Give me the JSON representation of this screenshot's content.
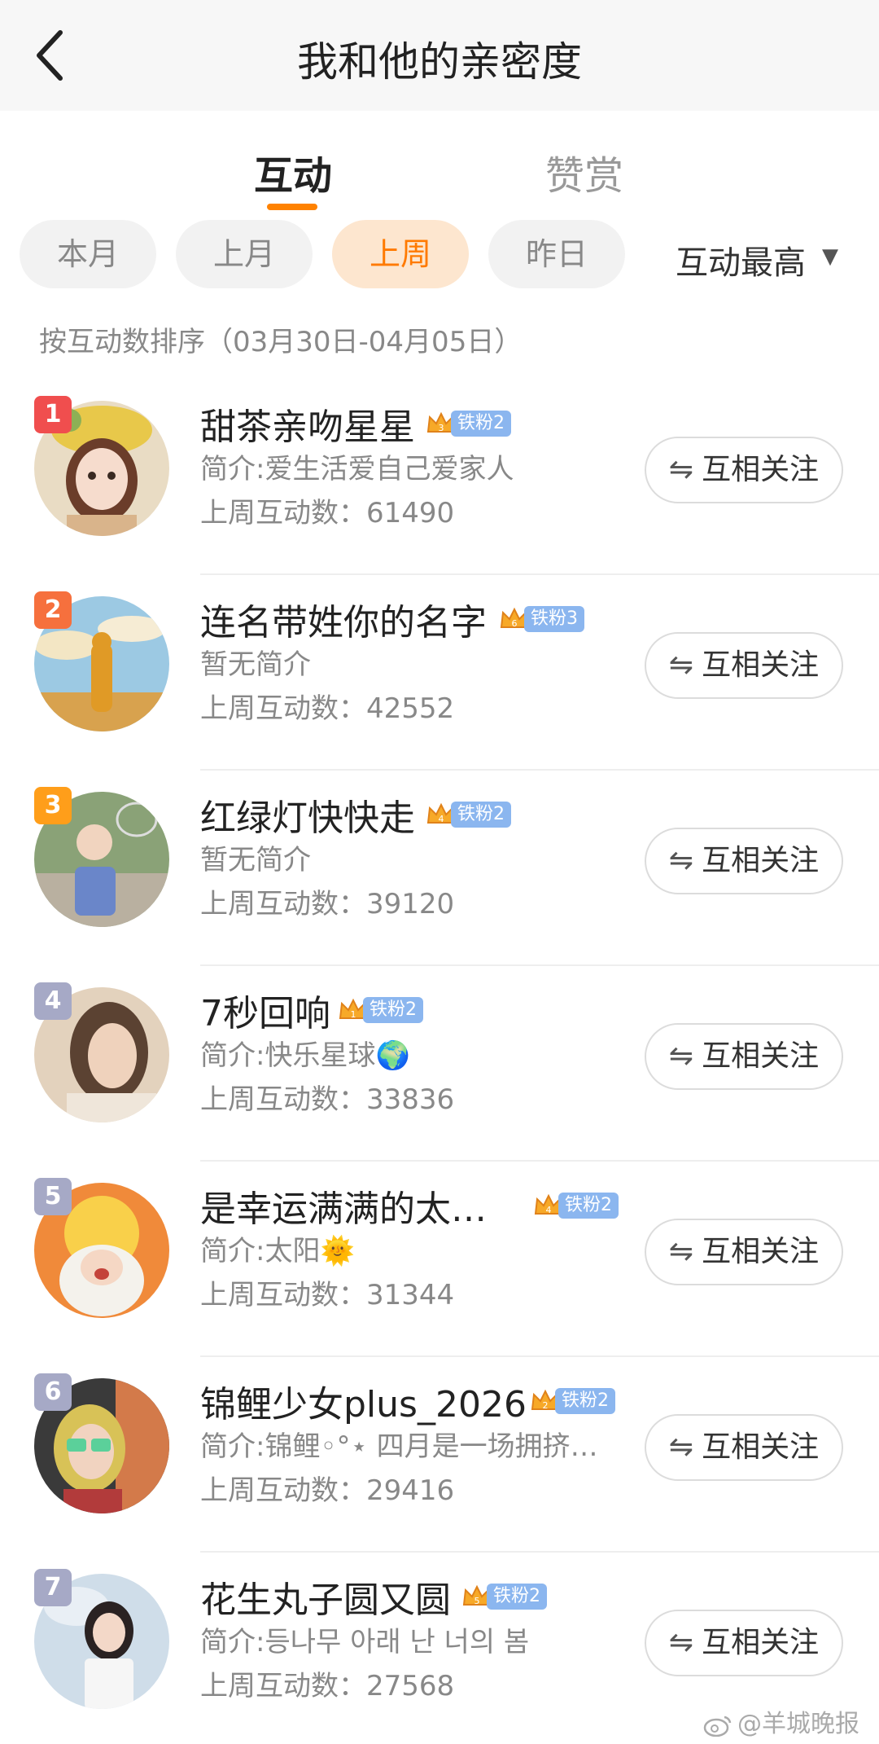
{
  "header": {
    "title": "我和他的亲密度",
    "back_icon": "chevron-left-icon"
  },
  "tabs": [
    {
      "label": "互动",
      "active": true
    },
    {
      "label": "赞赏",
      "active": false
    }
  ],
  "filters": {
    "chips": [
      "本月",
      "上月",
      "上周",
      "昨日"
    ],
    "active": "上周",
    "sort_label": "互动最高",
    "sort_arrow": "▼"
  },
  "sort_note": "按互动数排序（03月30日-04月05日）",
  "colors": {
    "accent": "#ff8200",
    "active_chip_bg": "#fde6cf",
    "badge": "#8bb6ef"
  },
  "users": [
    {
      "rank": "1",
      "name": "甜茶亲吻星星",
      "badge_level": "3",
      "badge": "铁粉2",
      "bio": "简介:爱生活爱自己爱家人",
      "count_label": "上周互动数：",
      "count": "61490",
      "follow": "互相关注"
    },
    {
      "rank": "2",
      "name": "连名带姓你的名字",
      "badge_level": "6",
      "badge": "铁粉3",
      "bio": "暂无简介",
      "count_label": "上周互动数：",
      "count": "42552",
      "follow": "互相关注"
    },
    {
      "rank": "3",
      "name": "红绿灯快快走",
      "badge_level": "4",
      "badge": "铁粉2",
      "bio": "暂无简介",
      "count_label": "上周互动数：",
      "count": "39120",
      "follow": "互相关注"
    },
    {
      "rank": "4",
      "name": "7秒回响",
      "badge_level": "1",
      "badge": "铁粉2",
      "bio": "简介:快乐星球🌍",
      "count_label": "上周互动数：",
      "count": "33836",
      "follow": "互相关注"
    },
    {
      "rank": "5",
      "name": "是幸运满满的太…",
      "badge_level": "4",
      "badge": "铁粉2",
      "bio": "简介:太阳🌞",
      "count_label": "上周互动数：",
      "count": "31344",
      "follow": "互相关注"
    },
    {
      "rank": "6",
      "name": "锦鲤少女plus_2026",
      "badge_level": "2",
      "badge": "铁粉2",
      "bio": "简介:锦鲤◦°⋆ 四月是一场拥挤…",
      "count_label": "上周互动数：",
      "count": "29416",
      "follow": "互相关注"
    },
    {
      "rank": "7",
      "name": "花生丸子圆又圆",
      "badge_level": "5",
      "badge": "铁粉2",
      "bio": "简介:등나무 아래 난 너의 봄",
      "count_label": "上周互动数：",
      "count": "27568",
      "follow": "互相关注"
    }
  ],
  "watermark": "@羊城晚报"
}
